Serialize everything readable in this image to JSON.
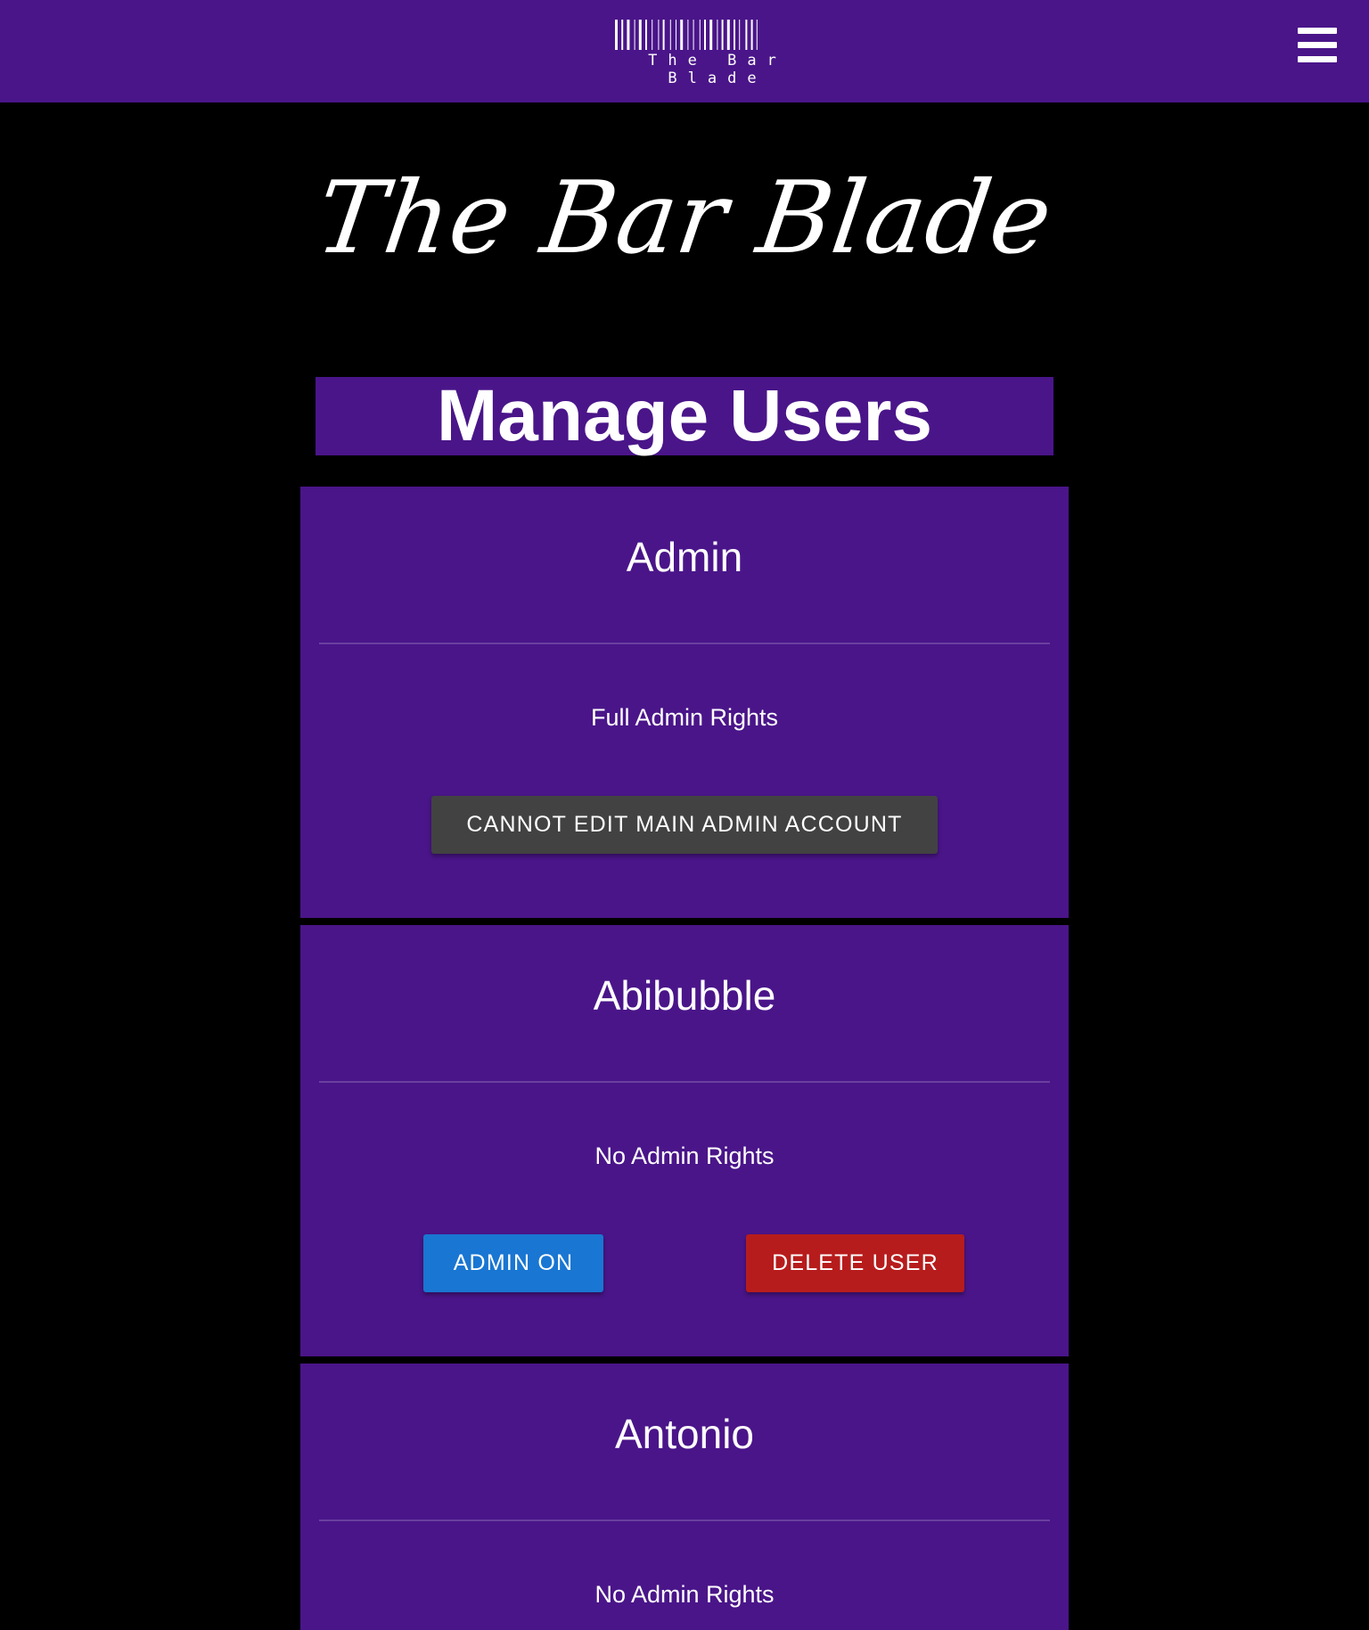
{
  "colors": {
    "nav_bg": "#4a1589",
    "page_bg": "#000000",
    "card_bg": "#4a1589",
    "disabled_button": "#424242",
    "admin_button": "#1976d2",
    "delete_button": "#b71c1c"
  },
  "navbar": {
    "logo_text": "The Bar Blade",
    "logo_icon": "barcode-icon",
    "menu_icon": "hamburger-menu-icon"
  },
  "hero": {
    "title": "The Bar Blade"
  },
  "page": {
    "title": "Manage Users"
  },
  "users": [
    {
      "name": "Admin",
      "rights": "Full Admin Rights",
      "button": "CANNOT EDIT MAIN ADMIN ACCOUNT"
    },
    {
      "name": "Abibubble",
      "rights": "No Admin Rights",
      "admin_button": "ADMIN ON",
      "delete_button": "DELETE USER"
    },
    {
      "name": "Antonio",
      "rights": "No Admin Rights"
    }
  ]
}
